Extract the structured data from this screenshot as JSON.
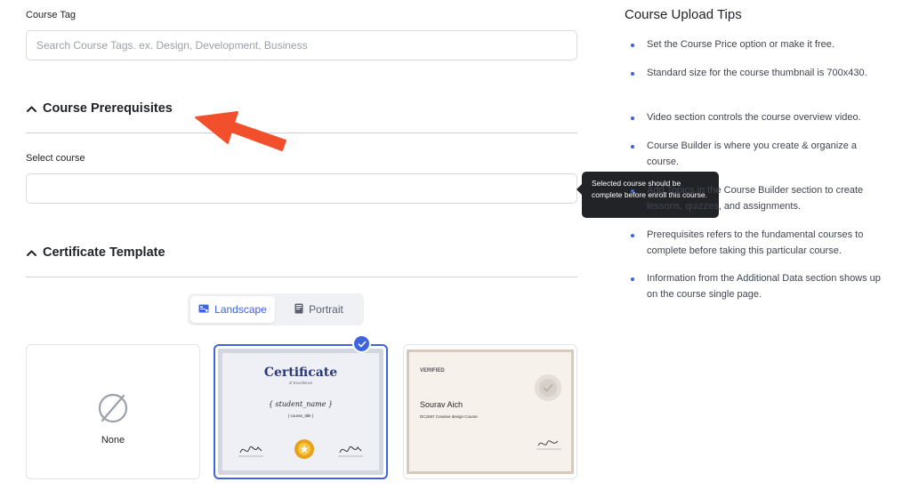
{
  "course_tag": {
    "label": "Course Tag",
    "placeholder": "Search Course Tags. ex. Design, Development, Business",
    "value": ""
  },
  "prerequisites": {
    "title": "Course Prerequisites",
    "select_label": "Select course",
    "select_value": "",
    "tooltip": "Selected course should be complete before enroll this course."
  },
  "certificate": {
    "title": "Certificate Template",
    "orientation_options": [
      {
        "label": "Landscape",
        "active": true
      },
      {
        "label": "Portrait",
        "active": false
      }
    ],
    "selected_template": 1,
    "templates": [
      {
        "label": "None"
      },
      {
        "heading": "Certificate",
        "subheading": "of Excellence",
        "name_placeholder": "{ student_name }",
        "course_placeholder": "{ course_title }"
      },
      {
        "heading": "VERIFIED",
        "recipient": "Sourav Aich",
        "course": "DC2087 Creative design Course"
      }
    ]
  },
  "tips": {
    "title": "Course Upload Tips",
    "items": [
      "Set the Course Price option or make it free.",
      "Standard size for the course thumbnail is 700x430.",
      "Video section controls the course overview video.",
      "Course Builder is where you create & organize a course.",
      "Add Topics in the Course Builder section to create lessons, quizzes, and assignments.",
      "Prerequisites refers to the fundamental courses to complete before taking this particular course.",
      "Information from the Additional Data section shows up on the course single page."
    ]
  },
  "colors": {
    "accent": "#3e64de",
    "annotation_arrow": "#f2502d",
    "tooltip_bg": "#212327"
  }
}
